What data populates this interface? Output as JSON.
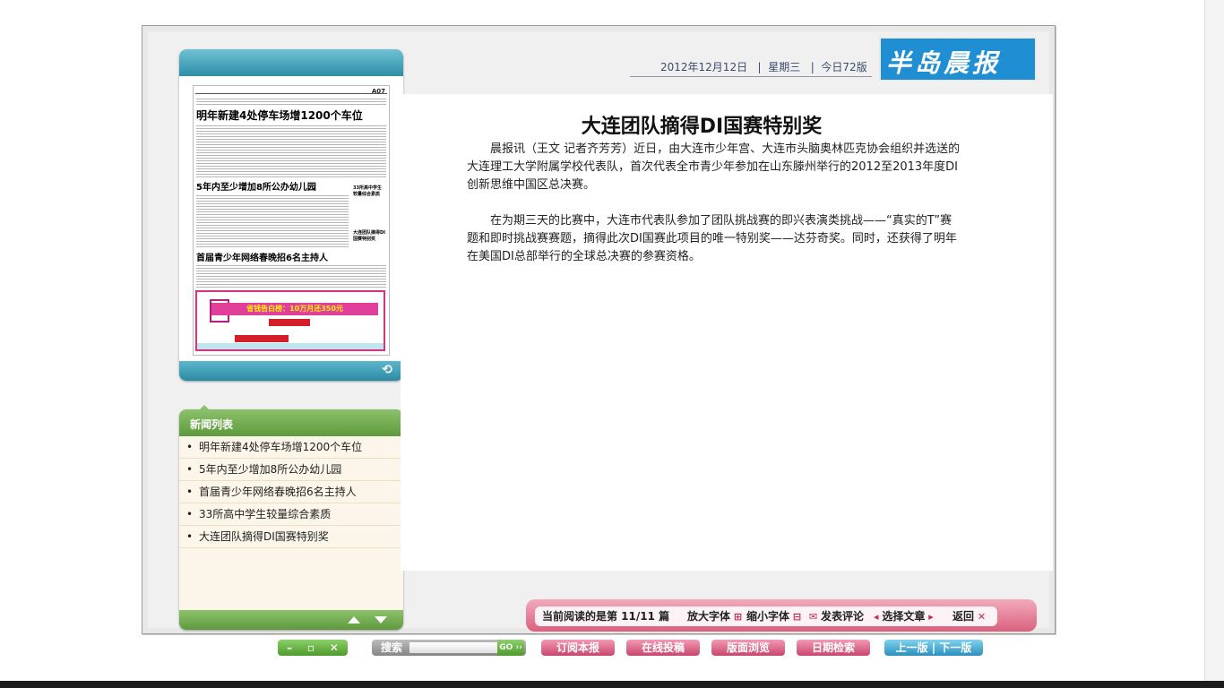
{
  "header": {
    "date": "2012年12月12日",
    "weekday": "星期三",
    "pages": "今日72版",
    "logo": "半岛晨报"
  },
  "thumbnail": {
    "page_code": "A07",
    "headlines": [
      "明年新建4处停车场增1200个车位",
      "5年内至少增加8所公办幼儿园",
      "首届青少年网络春晚招6名主持人"
    ],
    "side_notes": [
      "33所高中学生较量综合素质",
      "大连团队摘得DI国赛特别奖"
    ],
    "ad_text": "省钱告白榜：10万月还350元"
  },
  "news_list": {
    "title": "新闻列表",
    "items": [
      "明年新建4处停车场增1200个车位",
      "5年内至少增加8所公办幼儿园",
      "首届青少年网络春晚招6名主持人",
      "33所高中学生较量综合素质",
      "大连团队摘得DI国赛特别奖"
    ]
  },
  "article": {
    "title": "大连团队摘得DI国赛特别奖",
    "paragraphs": [
      "晨报讯（王文 记者齐芳芳）近日，由大连市少年宫、大连市头脑奥林匹克协会组织并选送的大连理工大学附属学校代表队，首次代表全市青少年参加在山东滕州举行的2012至2013年度DI创新思维中国区总决赛。",
      "在为期三天的比赛中，大连市代表队参加了团队挑战赛的即兴表演类挑战——“真实的T”赛题和即时挑战赛赛题，摘得此次DI国赛此项目的唯一特别奖——达芬奇奖。同时，还获得了明年在美国DI总部举行的全球总决赛的参赛资格。"
    ]
  },
  "toolbar": {
    "reading": "当前阅读的是第 11/11 篇",
    "enlarge": "放大字体",
    "shrink": "缩小字体",
    "comment": "发表评论",
    "select": "选择文章",
    "back": "返回"
  },
  "bottom": {
    "window_controls": [
      "–",
      "▫",
      "✕"
    ],
    "search_label": "搜索",
    "search_go": "GO",
    "subscribe": "订阅本报",
    "submit": "在线投稿",
    "browse": "版面浏览",
    "date_search": "日期检索",
    "prev": "上一版",
    "next": "下一版"
  }
}
